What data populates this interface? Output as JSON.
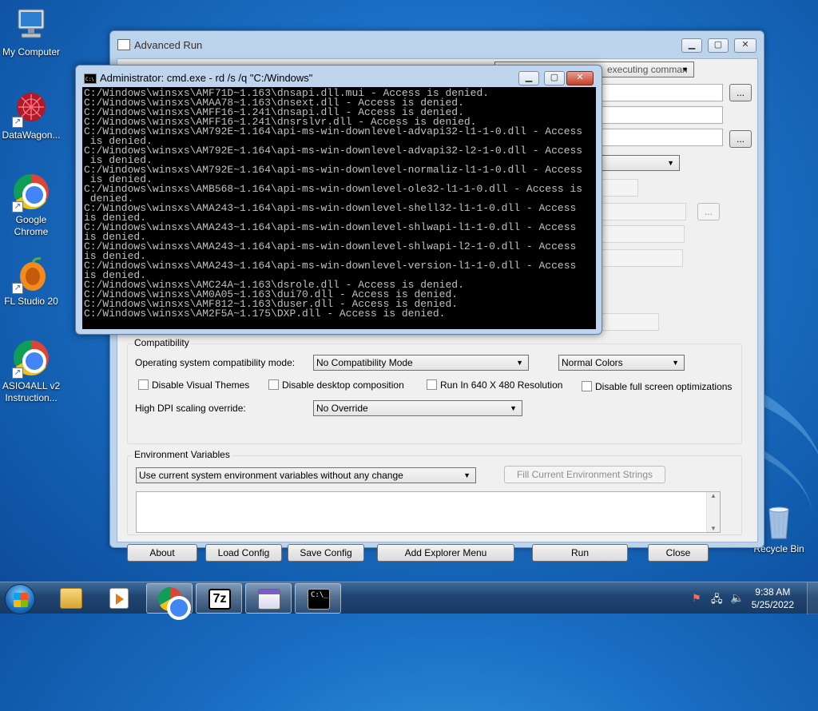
{
  "desktop": {
    "icons": [
      {
        "label": "My Computer"
      },
      {
        "label": "DataWagon..."
      },
      {
        "label": "Google Chrome"
      },
      {
        "label": "FL Studio 20"
      },
      {
        "label": "ASIO4ALL v2 Instruction..."
      },
      {
        "label": "Recycle Bin"
      }
    ]
  },
  "advanced_run": {
    "title": "Advanced Run",
    "partial_combo_text": "executing comman",
    "browse_label": "...",
    "compatibility": {
      "group_title": "Compatibility",
      "os_mode_label": "Operating system compatibility mode:",
      "os_mode_value": "No Compatibility Mode",
      "colors_value": "Normal Colors",
      "disable_visual_themes": "Disable Visual Themes",
      "disable_desktop_composition": "Disable desktop composition",
      "run_640": "Run In 640 X 480 Resolution",
      "disable_fullscreen_opt": "Disable full screen optimizations",
      "dpi_label": "High DPI scaling override:",
      "dpi_value": "No Override"
    },
    "environment": {
      "group_title": "Environment Variables",
      "mode_value": "Use current system environment variables without any change",
      "fill_button": "Fill Current Environment Strings"
    },
    "buttons": {
      "about": "About",
      "load_config": "Load Config",
      "save_config": "Save Config",
      "add_explorer_menu": "Add Explorer Menu",
      "run": "Run",
      "close": "Close"
    }
  },
  "cmd": {
    "title": "Administrator: cmd.exe - rd  /s /q \"C:/Windows\"",
    "icon_text": "C:\\",
    "lines": [
      "C:/Windows\\winsxs\\AMF71D~1.163\\dnsapi.dll.mui - Access is denied.",
      "C:/Windows\\winsxs\\AMAA78~1.163\\dnsext.dll - Access is denied.",
      "C:/Windows\\winsxs\\AMFF16~1.241\\dnsapi.dll - Access is denied.",
      "C:/Windows\\winsxs\\AMFF16~1.241\\dnsrslvr.dll - Access is denied.",
      "C:/Windows\\winsxs\\AM792E~1.164\\api-ms-win-downlevel-advapi32-l1-1-0.dll - Access",
      " is denied.",
      "C:/Windows\\winsxs\\AM792E~1.164\\api-ms-win-downlevel-advapi32-l2-1-0.dll - Access",
      " is denied.",
      "C:/Windows\\winsxs\\AM792E~1.164\\api-ms-win-downlevel-normaliz-l1-1-0.dll - Access",
      " is denied.",
      "C:/Windows\\winsxs\\AMB568~1.164\\api-ms-win-downlevel-ole32-l1-1-0.dll - Access is",
      " denied.",
      "C:/Windows\\winsxs\\AMA243~1.164\\api-ms-win-downlevel-shell32-l1-1-0.dll - Access",
      "is denied.",
      "C:/Windows\\winsxs\\AMA243~1.164\\api-ms-win-downlevel-shlwapi-l1-1-0.dll - Access",
      "is denied.",
      "C:/Windows\\winsxs\\AMA243~1.164\\api-ms-win-downlevel-shlwapi-l2-1-0.dll - Access",
      "is denied.",
      "C:/Windows\\winsxs\\AMA243~1.164\\api-ms-win-downlevel-version-l1-1-0.dll - Access",
      "is denied.",
      "C:/Windows\\winsxs\\AMC24A~1.163\\dsrole.dll - Access is denied.",
      "C:/Windows\\winsxs\\AM0A05~1.163\\dui70.dll - Access is denied.",
      "C:/Windows\\winsxs\\AMF812~1.163\\duser.dll - Access is denied.",
      "C:/Windows\\winsxs\\AM2F5A~1.175\\DXP.dll - Access is denied."
    ]
  },
  "taskbar": {
    "time": "9:38 AM",
    "date": "5/25/2022",
    "sevenzip_text": "7z",
    "cmd_icon_text": "C:\\_"
  }
}
